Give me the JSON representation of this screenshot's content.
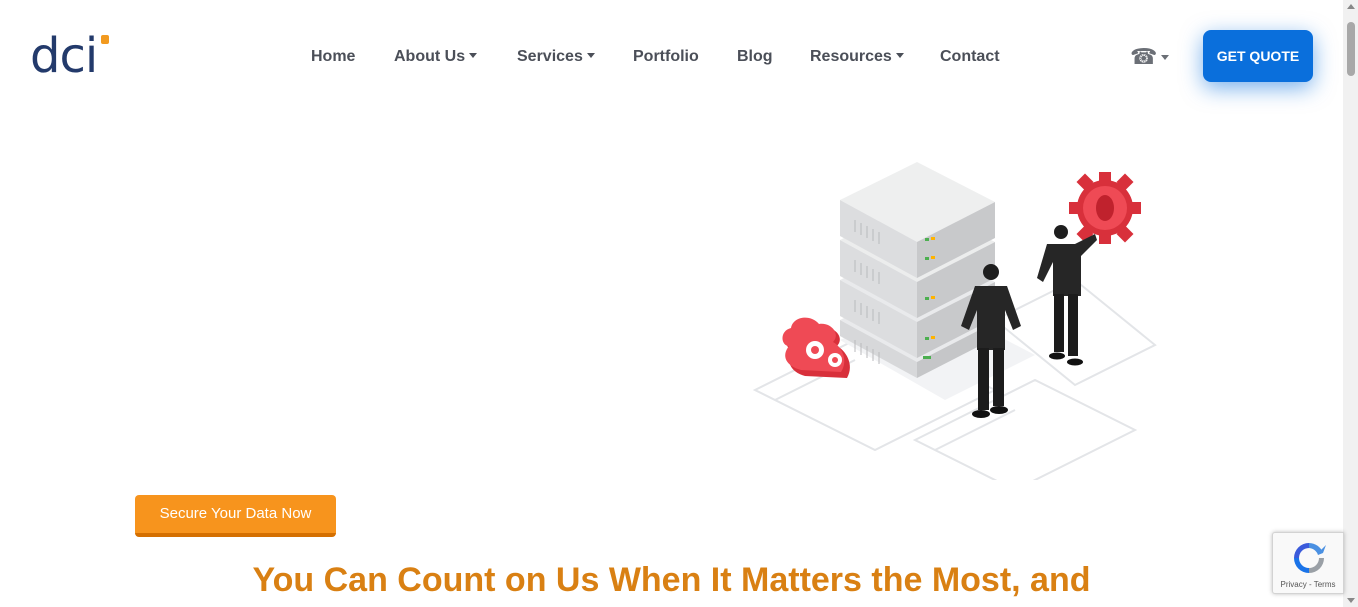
{
  "brand": {
    "logo_text": "dci",
    "logo_color": "#233a6b",
    "dot_color": "#f29a1f"
  },
  "nav": {
    "items": [
      {
        "label": "Home",
        "has_dropdown": false
      },
      {
        "label": "About Us",
        "has_dropdown": true
      },
      {
        "label": "Services",
        "has_dropdown": true
      },
      {
        "label": "Portfolio",
        "has_dropdown": false
      },
      {
        "label": "Blog",
        "has_dropdown": false
      },
      {
        "label": "Resources",
        "has_dropdown": true
      },
      {
        "label": "Contact",
        "has_dropdown": false
      }
    ],
    "phone_icon": "☎"
  },
  "header": {
    "quote_label": "GET QUOTE",
    "quote_color": "#0a6fdc"
  },
  "hero": {
    "cta_label": "Secure Your Data Now",
    "cta_color": "#f7941d",
    "headline": "You Can Count on Us When It Matters the Most, and",
    "headline_color": "#d98013"
  },
  "recaptcha": {
    "links": "Privacy - Terms"
  }
}
